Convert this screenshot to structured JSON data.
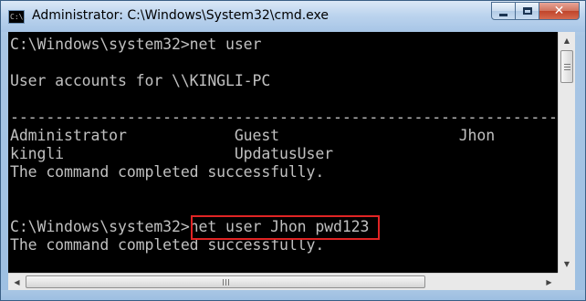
{
  "window": {
    "title": "Administrator: C:\\Windows\\System32\\cmd.exe",
    "app_icon_text": "C:\\.",
    "buttons": {
      "minimize": "minimize",
      "maximize": "maximize",
      "close": "✕"
    }
  },
  "console": {
    "lines": [
      "C:\\Windows\\system32>net user",
      "",
      "User accounts for \\\\KINGLI-PC",
      "",
      "-------------------------------------------------------------------------------",
      "Administrator            Guest                    Jhon",
      "kingli                   UpdatusUser",
      "The command completed successfully.",
      "",
      "",
      "C:\\Windows\\system32>net user Jhon pwd123",
      "The command completed successfully."
    ],
    "highlighted_command": "net user Jhon pwd123",
    "highlight_color": "#e02424",
    "text_color": "#c0c0c0",
    "background_color": "#000000"
  },
  "scrollbars": {
    "vertical": {
      "up_arrow": "▲",
      "down_arrow": "▼"
    },
    "horizontal": {
      "left_arrow": "◀",
      "right_arrow": "▶"
    }
  }
}
